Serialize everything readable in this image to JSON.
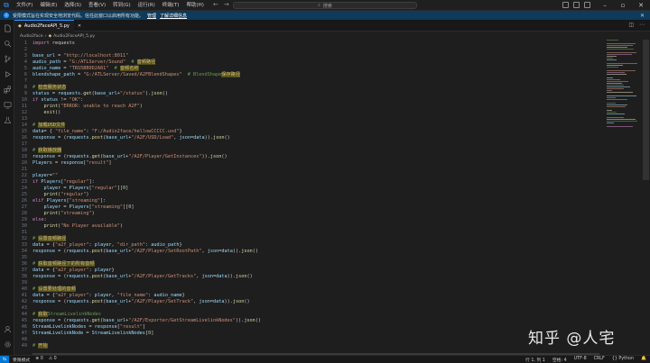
{
  "titlebar": {
    "menu": [
      "文件(F)",
      "编辑(E)",
      "选择(S)",
      "查看(V)",
      "转到(G)",
      "运行(R)",
      "终端(T)",
      "帮助(H)"
    ],
    "search_text": "搜索",
    "nav_back": "←",
    "nav_forward": "→"
  },
  "banner": {
    "message": "受限模式旨在实现安全地浏览代码。信任此窗口以启用所有功能。",
    "manage": "管理",
    "learn_more": "了解详细信息"
  },
  "tab": {
    "label": "Audio2FaceAPI_5.py"
  },
  "breadcrumb": {
    "folder": "Audio2face",
    "file": "Audio2FaceAPI_5.py"
  },
  "code_lines": [
    {
      "n": "1",
      "html": "<span class='kw'>import</span> <span class='code'>requests</span>"
    },
    {
      "n": "2",
      "html": ""
    },
    {
      "n": "3",
      "html": "<span class='var'>base_url</span> = <span class='str'>\"http://localhost:8011\"</span>"
    },
    {
      "n": "4",
      "html": "<span class='var'>audio_path</span> = <span class='str'>\"G:/ATLServer/Sound\"</span>  <span class='cm'># <span class='hl'>音频路径</span></span>"
    },
    {
      "n": "5",
      "html": "<span class='var'>audio_name</span> = <span class='str'>\"TRS5BB0D2A81\"</span>  <span class='cm'># <span class='hl'>音频名称</span></span>"
    },
    {
      "n": "6",
      "html": "<span class='var'>blendshape_path</span> = <span class='str'>\"G:/ATLServer/Saved/A2FBlendShapes\"</span>  <span class='cm'># BlendShape<span class='hl'>保存路径</span></span>"
    },
    {
      "n": "7",
      "html": ""
    },
    {
      "n": "8",
      "html": "<span class='cm'># <span class='hl'>检查服务状态</span></span>"
    },
    {
      "n": "9",
      "html": "<span class='var'>status</span> = <span class='var'>requests</span>.<span class='fn'>get</span>(<span class='var'>base_url</span>+<span class='str'>\"/status\"</span>).<span class='fn'>json</span>()"
    },
    {
      "n": "10",
      "html": "<span class='kw'>if</span> <span class='var'>status</span> != <span class='str'>\"OK\"</span>:"
    },
    {
      "n": "11",
      "html": "    <span class='fn'>print</span>(<span class='str'>\"ERROR: unable to reach A2F\"</span>)"
    },
    {
      "n": "12",
      "html": "    <span class='fn'>exit</span>()"
    },
    {
      "n": "13",
      "html": ""
    },
    {
      "n": "14",
      "html": "<span class='cm'># <span class='hl'>加载USD文件</span></span>"
    },
    {
      "n": "15",
      "html": "<span class='var'>data</span>= { <span class='str'>\"file_name\"</span>: <span class='str'>\"F:/Audio2face/hellowCCCCC.usd\"</span>}"
    },
    {
      "n": "16",
      "html": "<span class='var'>response</span> = (<span class='var'>requests</span>.<span class='fn'>post</span>(<span class='var'>base_url</span>+<span class='str'>\"/A2F/USD/Load\"</span>, <span class='var'>json</span>=<span class='var'>data</span>)).<span class='fn'>json</span>()"
    },
    {
      "n": "17",
      "html": ""
    },
    {
      "n": "18",
      "html": "<span class='cm'># <span class='hl'>获取播放器</span></span>"
    },
    {
      "n": "19",
      "html": "<span class='var'>response</span> = (<span class='var'>requests</span>.<span class='fn'>get</span>(<span class='var'>base_url</span>+<span class='str'>\"/A2F/Player/GetInstances\"</span>)).<span class='fn'>json</span>()"
    },
    {
      "n": "20",
      "html": "<span class='var'>Players</span> = <span class='var'>response</span>[<span class='str'>\"result\"</span>]"
    },
    {
      "n": "21",
      "html": ""
    },
    {
      "n": "22",
      "html": "<span class='var'>player</span>=<span class='str'>\"\"</span>"
    },
    {
      "n": "23",
      "html": "<span class='kw'>if</span> <span class='var'>Players</span>[<span class='str'>\"regular\"</span>]:"
    },
    {
      "n": "24",
      "html": "    <span class='var'>player</span> = <span class='var'>Players</span>[<span class='str'>\"regular\"</span>][<span class='num'>0</span>]"
    },
    {
      "n": "25",
      "html": "    <span class='fn'>print</span>(<span class='str'>\"regular\"</span>)"
    },
    {
      "n": "26",
      "html": "<span class='kw'>elif</span> <span class='var'>Players</span>[<span class='str'>\"streaming\"</span>]:"
    },
    {
      "n": "27",
      "html": "    <span class='var'>player</span> = <span class='var'>Players</span>[<span class='str'>\"streaming\"</span>][<span class='num'>0</span>]"
    },
    {
      "n": "28",
      "html": "    <span class='fn'>print</span>(<span class='str'>\"streaming\"</span>)"
    },
    {
      "n": "29",
      "html": "<span class='kw'>else</span>:"
    },
    {
      "n": "30",
      "html": "    <span class='fn'>print</span>(<span class='str'>\"No Player available\"</span>)"
    },
    {
      "n": "31",
      "html": ""
    },
    {
      "n": "32",
      "html": "<span class='cm'># <span class='hl'>设置音频路径</span></span>"
    },
    {
      "n": "33",
      "html": "<span class='var'>data</span> = {<span class='str'>\"a2f_player\"</span>: <span class='var'>player</span>, <span class='str'>\"dir_path\"</span>: <span class='var'>audio_path</span>}"
    },
    {
      "n": "34",
      "html": "<span class='var'>response</span> = (<span class='var'>requests</span>.<span class='fn'>post</span>(<span class='var'>base_url</span>+<span class='str'>\"/A2F/Player/SetRootPath\"</span>, <span class='var'>json</span>=<span class='var'>data</span>)).<span class='fn'>json</span>()"
    },
    {
      "n": "35",
      "html": ""
    },
    {
      "n": "36",
      "html": "<span class='cm'># <span class='hl'>获取音频路径下的所有音频</span></span>"
    },
    {
      "n": "37",
      "html": "<span class='var'>data</span> = {<span class='str'>\"a2f_player\"</span>: <span class='var'>player</span>}"
    },
    {
      "n": "38",
      "html": "<span class='var'>response</span> = (<span class='var'>requests</span>.<span class='fn'>post</span>(<span class='var'>base_url</span>+<span class='str'>\"/A2F/Player/GetTracks\"</span>, <span class='var'>json</span>=<span class='var'>data</span>)).<span class='fn'>json</span>()"
    },
    {
      "n": "39",
      "html": ""
    },
    {
      "n": "40",
      "html": "<span class='cm'># <span class='hl'>设置要处理的音频</span></span>"
    },
    {
      "n": "41",
      "html": "<span class='var'>data</span> = {<span class='str'>\"a2f_player\"</span>: <span class='var'>player</span>, <span class='str'>\"file_name\"</span>: <span class='var'>audio_name</span>}"
    },
    {
      "n": "42",
      "html": "<span class='var'>response</span> = (<span class='var'>requests</span>.<span class='fn'>post</span>(<span class='var'>base_url</span>+<span class='str'>\"/A2F/Player/SetTrack\"</span>, <span class='var'>json</span>=<span class='var'>data</span>)).<span class='fn'>json</span>()"
    },
    {
      "n": "43",
      "html": ""
    },
    {
      "n": "44",
      "html": "<span class='cm'># <span class='hl'>获取</span>StreamLivelinkNodes</span>"
    },
    {
      "n": "45",
      "html": "<span class='var'>response</span> = (<span class='var'>requests</span>.<span class='fn'>get</span>(<span class='var'>base_url</span>+<span class='str'>\"/A2F/Exporter/GetStreamLivelinkNodes\"</span>)).<span class='fn'>json</span>()"
    },
    {
      "n": "46",
      "html": "<span class='var'>StreamLivelinkNodes</span> = <span class='var'>response</span>[<span class='str'>\"result\"</span>]"
    },
    {
      "n": "47",
      "html": "<span class='var'>StreamLivelinkNode</span> = <span class='var'>StreamLivelinkNodes</span>[<span class='num'>0</span>]"
    },
    {
      "n": "48",
      "html": ""
    },
    {
      "n": "49",
      "html": "<span class='cm'># <span class='hl'>开始</span></span>"
    }
  ],
  "watermark": "知乎 @人宅",
  "statusbar": {
    "restricted": "受限模式",
    "errors": "⊗ 0",
    "warnings": "⚠ 0",
    "position": "行 1, 列 1",
    "spaces": "空格: 4",
    "encoding": "UTF-8",
    "eol": "CRLF",
    "language": "{} Python"
  },
  "colors": {
    "accent": "#3794ff",
    "banner_bg": "#0e3a5b",
    "editor_bg": "#1e1e1e"
  }
}
